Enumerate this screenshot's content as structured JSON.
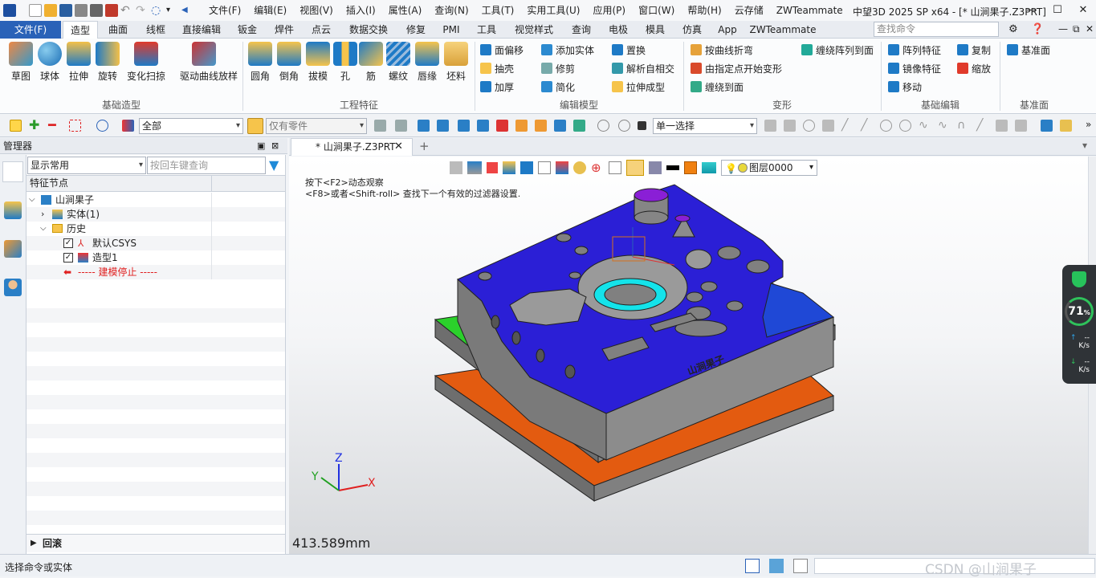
{
  "app": {
    "title": "中望3D 2025 SP x64 - [* 山涧果子.Z3PRT]"
  },
  "menu": [
    "文件(F)",
    "编辑(E)",
    "视图(V)",
    "插入(I)",
    "属性(A)",
    "查询(N)",
    "工具(T)",
    "实用工具(U)",
    "应用(P)",
    "窗口(W)",
    "帮助(H)",
    "云存储",
    "ZWTeammate"
  ],
  "tabs": {
    "file": "文件(F)",
    "items": [
      "造型",
      "曲面",
      "线框",
      "直接编辑",
      "钣金",
      "焊件",
      "点云",
      "数据交换",
      "修复",
      "PMI",
      "工具",
      "视觉样式",
      "查询",
      "电极",
      "模具",
      "仿真",
      "App",
      "ZWTeammate"
    ],
    "active": "造型"
  },
  "search": {
    "placeholder": "查找命令"
  },
  "ribbon": {
    "basic": [
      "草图",
      "球体",
      "拉伸",
      "旋转",
      "变化扫掠",
      "驱动曲线放样"
    ],
    "basic_group": "基础造型",
    "eng": [
      "圆角",
      "倒角",
      "拔模",
      "孔",
      "筋",
      "螺纹",
      "唇缘",
      "坯料"
    ],
    "eng_group": "工程特征",
    "edit": [
      "面偏移",
      "抽壳",
      "加厚",
      "添加实体",
      "修剪",
      "简化",
      "置换",
      "解析自相交",
      "拉伸成型"
    ],
    "edit_group": "编辑模型",
    "deform": [
      "按曲线折弯",
      "由指定点开始变形",
      "缠绕到面",
      "缠绕阵列到面"
    ],
    "deform_group": "变形",
    "basicedit": [
      "阵列特征",
      "镜像特征",
      "移动",
      "复制",
      "缩放"
    ],
    "basicedit_group": "基础编辑",
    "datum": [
      "基准面"
    ],
    "datum_group": "基准面"
  },
  "toolbar2": {
    "filter": "全部",
    "part_only": "仅有零件",
    "select_mode": "单一选择"
  },
  "manager": {
    "title": "管理器",
    "display": "显示常用",
    "query_placeholder": "按回车键查询",
    "column": "特征节点",
    "tree": [
      "山涧果子",
      "实体(1)",
      "历史",
      "默认CSYS",
      "造型1",
      "----- 建模停止 -----"
    ],
    "footer": "回滚"
  },
  "view": {
    "doc_tab": "* 山涧果子.Z3PRT",
    "hint1": "按下<F2>动态观察",
    "hint2": "<F8>或者<Shift-roll> 查找下一个有效的过滤器设置.",
    "layer": "图层0000",
    "scale": "413.589mm",
    "axis_x": "X",
    "axis_y": "Y",
    "axis_z": "Z",
    "engraving": "山涧果子"
  },
  "widget": {
    "percent": "71",
    "pct_sign": "%",
    "up": "--",
    "down": "--",
    "unit": "K/s"
  },
  "status": {
    "text": "选择命令或实体",
    "watermark": "CSDN @山涧果子"
  },
  "colors": {
    "accent": "#2a62b8",
    "top_face": "#2b1fd6",
    "side": "#808080",
    "base": "#e15a10",
    "green": "#2bd12b",
    "cyan": "#14e3ea"
  }
}
